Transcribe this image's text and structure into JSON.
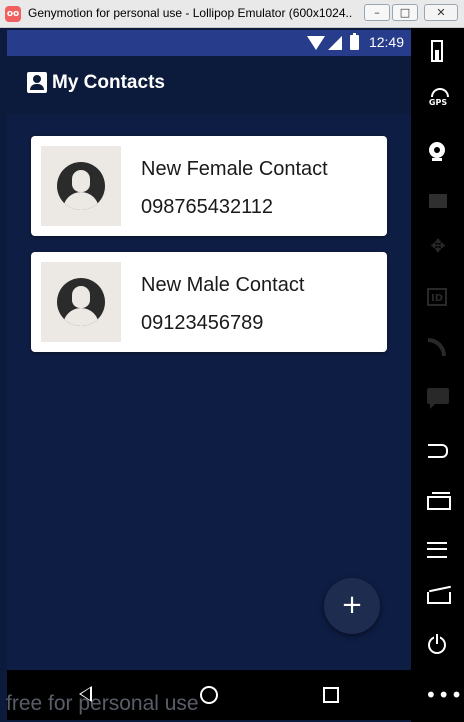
{
  "window": {
    "app_icon": "oo",
    "title": "Genymotion for personal use - Lollipop Emulator (600x1024...",
    "min_label": "–",
    "max_label": "□",
    "close_label": "✕"
  },
  "status_bar": {
    "time": "12:49",
    "icons": [
      "wifi-icon",
      "signal-icon",
      "battery-icon"
    ]
  },
  "app_bar": {
    "title": "My Contacts",
    "icon": "account-box-icon"
  },
  "contacts": [
    {
      "name": "New Female Contact",
      "phone": "098765432112",
      "avatar": "female-avatar-icon"
    },
    {
      "name": "New Male Contact",
      "phone": "09123456789",
      "avatar": "male-avatar-icon"
    }
  ],
  "fab": {
    "label": "+"
  },
  "nav_bar": {
    "icons": [
      "back-icon",
      "home-icon",
      "recents-icon"
    ]
  },
  "side_panel": {
    "gps_label": "GPS",
    "id_label": "ID",
    "more_label": "•••",
    "move_label": "✥"
  },
  "watermark": "free for personal use",
  "colors": {
    "background": "#0c1a3b",
    "status_bar": "#283c8c",
    "card": "#ffffff",
    "fab": "#1d2c4f"
  }
}
